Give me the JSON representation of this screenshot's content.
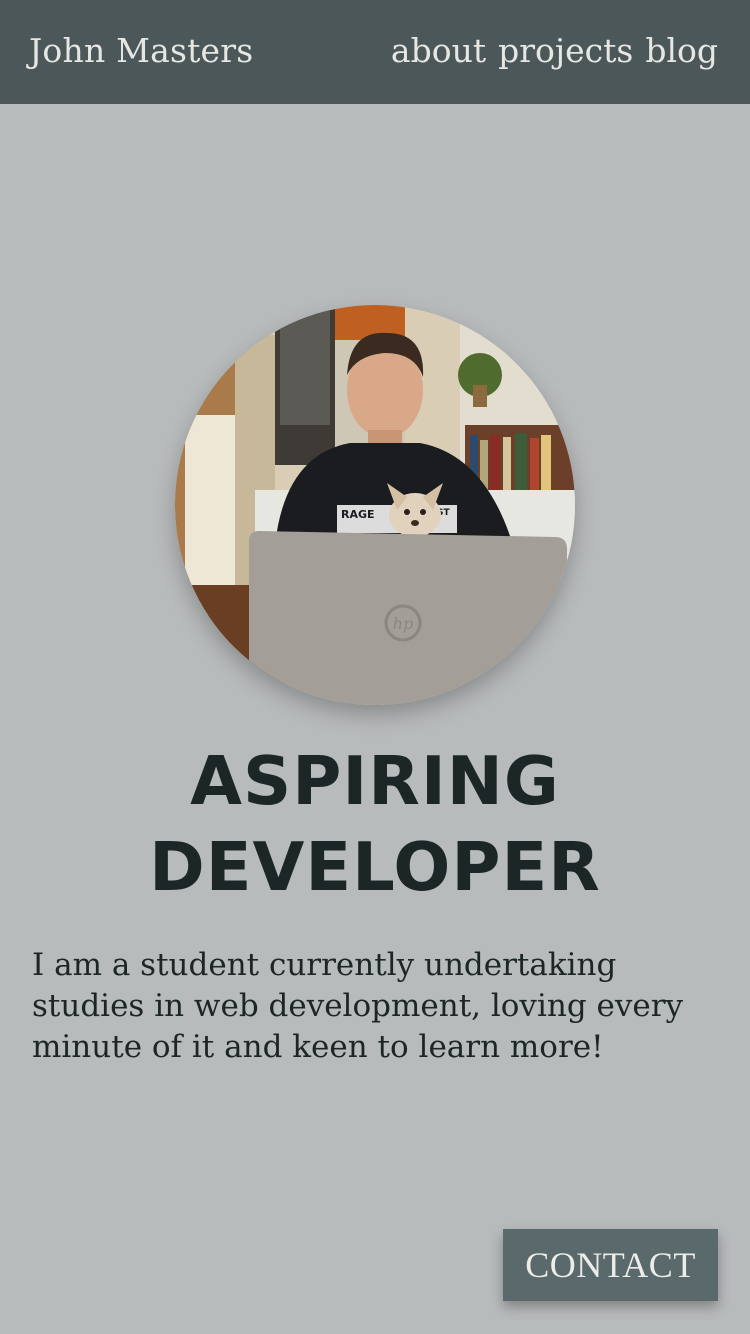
{
  "header": {
    "brand": "John Masters",
    "nav": [
      {
        "label": "about"
      },
      {
        "label": "projects"
      },
      {
        "label": "blog"
      }
    ]
  },
  "hero": {
    "photo_subject": "profile-photo",
    "laptop_logo": "hp",
    "shirt_text": "RAGE",
    "shirt_text_2": "ST",
    "headline_line1": "ASPIRING",
    "headline_line2": "DEVELOPER",
    "intro": "I am a student currently undertaking studies in web development, loving every minute of it and keen to learn more!"
  },
  "contact": {
    "label": "CONTACT"
  },
  "colors": {
    "navbar": "#4b5759",
    "background": "#b8bbbc",
    "text_dark": "#1d2627",
    "button": "#5a6a6c"
  }
}
